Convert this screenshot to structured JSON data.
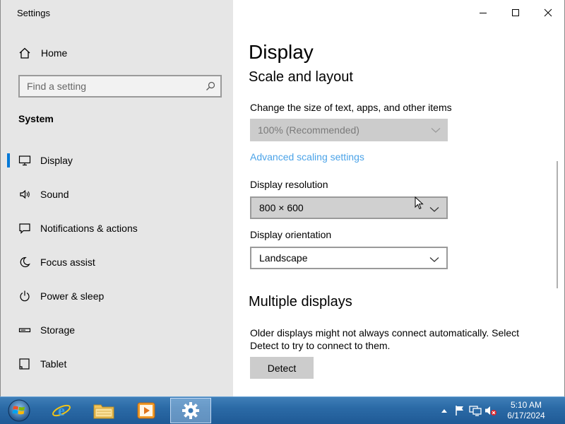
{
  "window": {
    "app_title": "Settings",
    "controls": {
      "minimize": "minimize",
      "maximize": "maximize",
      "close": "close"
    }
  },
  "sidebar": {
    "home_label": "Home",
    "search": {
      "placeholder": "Find a setting",
      "value": ""
    },
    "section_title": "System",
    "items": [
      {
        "label": "Display",
        "icon": "monitor-icon",
        "active": true
      },
      {
        "label": "Sound",
        "icon": "speaker-icon"
      },
      {
        "label": "Notifications & actions",
        "icon": "notification-icon"
      },
      {
        "label": "Focus assist",
        "icon": "moon-icon"
      },
      {
        "label": "Power & sleep",
        "icon": "power-icon"
      },
      {
        "label": "Storage",
        "icon": "storage-icon"
      },
      {
        "label": "Tablet",
        "icon": "tablet-icon"
      }
    ]
  },
  "content": {
    "page_title": "Display",
    "scale_header": "Scale and layout",
    "size_label": "Change the size of text, apps, and other items",
    "scale_value": "100% (Recommended)",
    "advanced_link": "Advanced scaling settings",
    "resolution_label": "Display resolution",
    "resolution_value": "800 × 600",
    "orientation_label": "Display orientation",
    "orientation_value": "Landscape",
    "multi_header": "Multiple displays",
    "multi_desc": "Older displays might not always connect automatically. Select Detect to try to connect to them.",
    "detect_label": "Detect"
  },
  "taskbar": {
    "apps": [
      {
        "name": "internet-explorer-icon"
      },
      {
        "name": "file-explorer-icon"
      },
      {
        "name": "media-player-icon"
      },
      {
        "name": "settings-gear-icon",
        "active": true
      }
    ],
    "clock": {
      "time": "5:10 AM",
      "date": "6/17/2024"
    }
  },
  "colors": {
    "accent": "#0078d7",
    "link": "#4ba3e8",
    "sidebar_bg": "#e6e6e6",
    "taskbar": "#2b6aa6"
  }
}
